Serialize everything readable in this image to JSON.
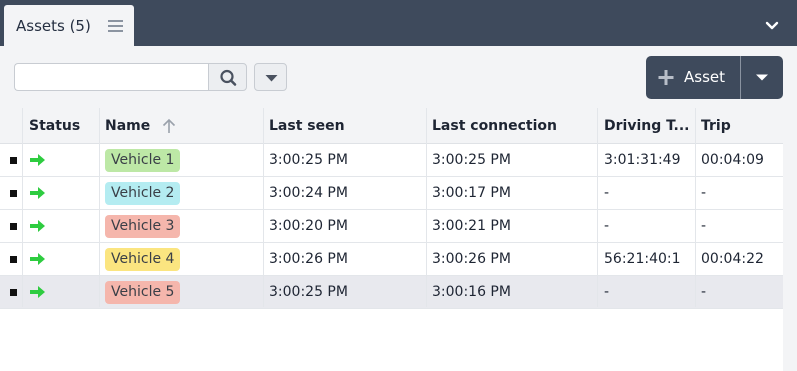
{
  "panel": {
    "tab_label": "Assets (5)"
  },
  "toolbar": {
    "search_value": "",
    "add_label": "Asset"
  },
  "colors": {
    "header_dark": "#3e4a5c",
    "status_green": "#2ecc40"
  },
  "icons": {
    "tab_menu": "hamburger-icon",
    "collapse": "chevron-down-icon",
    "search": "search-icon",
    "filter": "caret-down-icon",
    "add": "plus-icon",
    "add_menu": "caret-down-icon",
    "sort": "arrow-up-icon",
    "status": "arrow-right-icon"
  },
  "table": {
    "columns": {
      "status": "Status",
      "name": "Name",
      "last_seen": "Last seen",
      "last_connection": "Last connection",
      "driving_time": "Driving T...",
      "trip": "Trip"
    },
    "sort": {
      "column": "Name",
      "direction": "ascending"
    },
    "rows": [
      {
        "name": "Vehicle 1",
        "color": "#bde8a6",
        "last_seen": "3:00:25 PM",
        "last_connection": "3:00:25 PM",
        "driving_time": "3:01:31:49",
        "trip": "00:04:09",
        "selected": false
      },
      {
        "name": "Vehicle 2",
        "color": "#b4ecf1",
        "last_seen": "3:00:24 PM",
        "last_connection": "3:00:17 PM",
        "driving_time": "-",
        "trip": "-",
        "selected": false
      },
      {
        "name": "Vehicle 3",
        "color": "#f5b6ac",
        "last_seen": "3:00:20 PM",
        "last_connection": "3:00:21 PM",
        "driving_time": "-",
        "trip": "-",
        "selected": false
      },
      {
        "name": "Vehicle 4",
        "color": "#fbe580",
        "last_seen": "3:00:26 PM",
        "last_connection": "3:00:26 PM",
        "driving_time": "56:21:40:1",
        "trip": "00:04:22",
        "selected": false
      },
      {
        "name": "Vehicle 5",
        "color": "#f5b6ac",
        "last_seen": "3:00:25 PM",
        "last_connection": "3:00:16 PM",
        "driving_time": "-",
        "trip": "-",
        "selected": true
      }
    ]
  }
}
